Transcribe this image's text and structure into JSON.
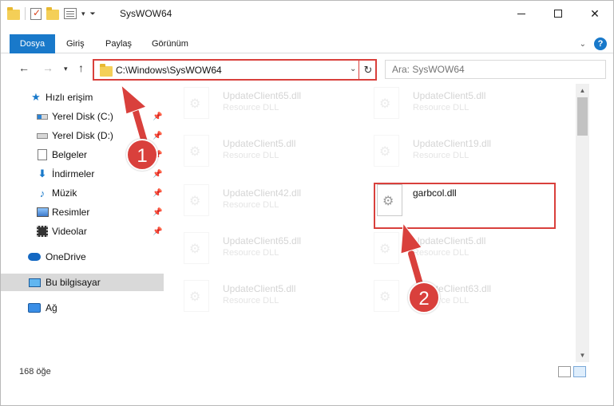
{
  "window": {
    "title": "SysWOW64"
  },
  "ribbon": {
    "tabs": [
      {
        "label": "Dosya"
      },
      {
        "label": "Giriş"
      },
      {
        "label": "Paylaş"
      },
      {
        "label": "Görünüm"
      }
    ]
  },
  "address": {
    "path": "C:\\Windows\\SysWOW64"
  },
  "search": {
    "placeholder": "Ara: SysWOW64"
  },
  "sidebar": {
    "items": [
      {
        "label": "Hızlı erişim",
        "icon": "star-icon"
      },
      {
        "label": "Yerel Disk (C:)",
        "icon": "drive-icon"
      },
      {
        "label": "Yerel Disk (D:)",
        "icon": "drive-icon"
      },
      {
        "label": "Belgeler",
        "icon": "documents-icon"
      },
      {
        "label": "İndirmeler",
        "icon": "download-icon"
      },
      {
        "label": "Müzik",
        "icon": "music-icon"
      },
      {
        "label": "Resimler",
        "icon": "pictures-icon"
      },
      {
        "label": "Videolar",
        "icon": "video-icon"
      },
      {
        "label": "OneDrive",
        "icon": "cloud-icon"
      },
      {
        "label": "Bu bilgisayar",
        "icon": "computer-icon"
      },
      {
        "label": "Ağ",
        "icon": "network-icon"
      }
    ]
  },
  "files": [
    {
      "name": "UpdateClient65.dll",
      "type": "Resource DLL"
    },
    {
      "name": "UpdateClient5.dll",
      "type": "Resource DLL"
    },
    {
      "name": "UpdateClient5.dll",
      "type": "Resource DLL"
    },
    {
      "name": "UpdateClient19.dll",
      "type": "Resource DLL"
    },
    {
      "name": "UpdateClient42.dll",
      "type": "Resource DLL"
    },
    {
      "name": "garbcol.dll",
      "type": ""
    },
    {
      "name": "UpdateClient65.dll",
      "type": "Resource DLL"
    },
    {
      "name": "UpdateClient5.dll",
      "type": "Resource DLL"
    },
    {
      "name": "UpdateClient5.dll",
      "type": "Resource DLL"
    },
    {
      "name": "UpdateClient63.dll",
      "type": "Resource DLL"
    }
  ],
  "status": {
    "count": "168 öğe"
  },
  "callouts": {
    "one": "1",
    "two": "2"
  },
  "colors": {
    "accent": "#1979ca",
    "highlight": "#d9403c"
  }
}
